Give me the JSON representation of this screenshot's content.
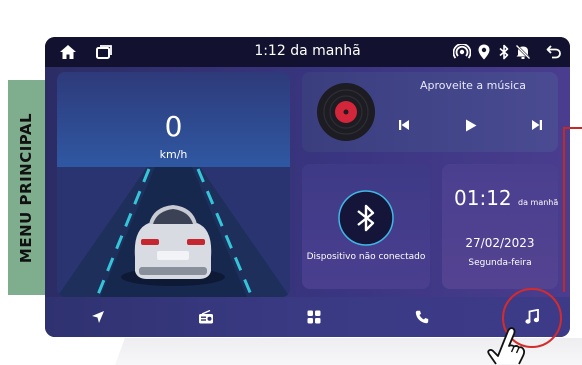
{
  "side_tab": {
    "label": "MENU PRINCIPAL"
  },
  "status_bar": {
    "time": "1:12 da manhã",
    "icons": [
      "home-icon",
      "recent-apps-icon",
      "hotspot-icon",
      "location-icon",
      "bluetooth-icon",
      "mute-icon",
      "back-icon"
    ]
  },
  "speedometer": {
    "value": "0",
    "unit": "km/h"
  },
  "music": {
    "title": "Aproveite a música",
    "controls": [
      "previous-icon",
      "play-icon",
      "next-icon"
    ]
  },
  "bluetooth": {
    "status": "Dispositivo não conectado"
  },
  "clock": {
    "time": "01:12",
    "suffix": "da manhã",
    "date": "27/02/2023",
    "weekday": "Segunda-feira"
  },
  "nav": {
    "items": [
      "navigation-icon",
      "radio-icon",
      "apps-grid-icon",
      "phone-icon",
      "music-note-icon"
    ]
  },
  "colors": {
    "accent": "#d62b2b",
    "side_tab": "#7fae8f",
    "background": "#151433"
  }
}
